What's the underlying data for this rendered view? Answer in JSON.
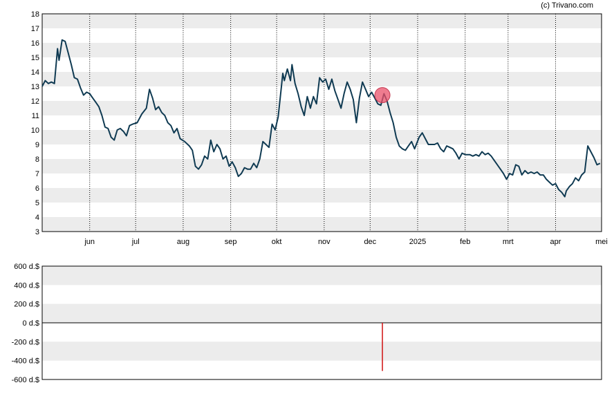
{
  "credit": "(c) Trivano.com",
  "chart_data": [
    {
      "type": "line",
      "ylim": [
        3,
        18
      ],
      "yticks": [
        "3",
        "4",
        "5",
        "6",
        "7",
        "8",
        "9",
        "10",
        "11",
        "12",
        "13",
        "14",
        "15",
        "16",
        "17",
        "18"
      ],
      "x_range": [
        "2024-05-01",
        "2025-05-01"
      ],
      "xtick_labels": [
        {
          "date": "2024-06-01",
          "label": "jun"
        },
        {
          "date": "2024-07-01",
          "label": "jul"
        },
        {
          "date": "2024-08-01",
          "label": "aug"
        },
        {
          "date": "2024-09-01",
          "label": "sep"
        },
        {
          "date": "2024-10-01",
          "label": "okt"
        },
        {
          "date": "2024-11-01",
          "label": "nov"
        },
        {
          "date": "2024-12-01",
          "label": "dec"
        },
        {
          "date": "2025-01-01",
          "label": "2025"
        },
        {
          "date": "2025-02-01",
          "label": "feb"
        },
        {
          "date": "2025-03-01",
          "label": "mrt"
        },
        {
          "date": "2025-04-01",
          "label": "apr"
        },
        {
          "date": "2025-05-01",
          "label": "mei"
        }
      ],
      "grid": "horizontal bands + dotted vertical lines",
      "line_color": "#0f3a52",
      "series": [
        {
          "points": [
            [
              "2024-05-01",
              13.0
            ],
            [
              "2024-05-03",
              13.4
            ],
            [
              "2024-05-05",
              13.2
            ],
            [
              "2024-05-07",
              13.3
            ],
            [
              "2024-05-09",
              13.2
            ],
            [
              "2024-05-11",
              15.6
            ],
            [
              "2024-05-12",
              14.8
            ],
            [
              "2024-05-14",
              16.2
            ],
            [
              "2024-05-16",
              16.1
            ],
            [
              "2024-05-18",
              15.3
            ],
            [
              "2024-05-20",
              14.5
            ],
            [
              "2024-05-22",
              13.6
            ],
            [
              "2024-05-24",
              13.5
            ],
            [
              "2024-05-26",
              12.9
            ],
            [
              "2024-05-28",
              12.4
            ],
            [
              "2024-05-30",
              12.6
            ],
            [
              "2024-06-01",
              12.5
            ],
            [
              "2024-06-03",
              12.2
            ],
            [
              "2024-06-05",
              11.9
            ],
            [
              "2024-06-07",
              11.6
            ],
            [
              "2024-06-09",
              11.0
            ],
            [
              "2024-06-11",
              10.2
            ],
            [
              "2024-06-13",
              10.1
            ],
            [
              "2024-06-15",
              9.5
            ],
            [
              "2024-06-17",
              9.3
            ],
            [
              "2024-06-19",
              10.0
            ],
            [
              "2024-06-21",
              10.1
            ],
            [
              "2024-06-23",
              9.9
            ],
            [
              "2024-06-25",
              9.6
            ],
            [
              "2024-06-27",
              10.3
            ],
            [
              "2024-06-29",
              10.4
            ],
            [
              "2024-07-02",
              10.5
            ],
            [
              "2024-07-05",
              11.1
            ],
            [
              "2024-07-08",
              11.5
            ],
            [
              "2024-07-10",
              12.8
            ],
            [
              "2024-07-12",
              12.2
            ],
            [
              "2024-07-14",
              11.4
            ],
            [
              "2024-07-16",
              11.6
            ],
            [
              "2024-07-18",
              11.2
            ],
            [
              "2024-07-20",
              11.0
            ],
            [
              "2024-07-22",
              10.5
            ],
            [
              "2024-07-24",
              10.3
            ],
            [
              "2024-07-26",
              9.8
            ],
            [
              "2024-07-28",
              10.1
            ],
            [
              "2024-07-30",
              9.4
            ],
            [
              "2024-08-02",
              9.2
            ],
            [
              "2024-08-05",
              8.9
            ],
            [
              "2024-08-07",
              8.6
            ],
            [
              "2024-08-09",
              7.5
            ],
            [
              "2024-08-11",
              7.3
            ],
            [
              "2024-08-13",
              7.6
            ],
            [
              "2024-08-15",
              8.2
            ],
            [
              "2024-08-17",
              8.0
            ],
            [
              "2024-08-19",
              9.3
            ],
            [
              "2024-08-21",
              8.5
            ],
            [
              "2024-08-23",
              9.0
            ],
            [
              "2024-08-25",
              8.7
            ],
            [
              "2024-08-27",
              8.0
            ],
            [
              "2024-08-29",
              8.2
            ],
            [
              "2024-08-31",
              7.5
            ],
            [
              "2024-09-02",
              7.8
            ],
            [
              "2024-09-04",
              7.4
            ],
            [
              "2024-09-06",
              6.8
            ],
            [
              "2024-09-08",
              7.0
            ],
            [
              "2024-09-10",
              7.4
            ],
            [
              "2024-09-12",
              7.3
            ],
            [
              "2024-09-14",
              7.3
            ],
            [
              "2024-09-16",
              7.7
            ],
            [
              "2024-09-18",
              7.4
            ],
            [
              "2024-09-20",
              8.0
            ],
            [
              "2024-09-22",
              9.2
            ],
            [
              "2024-09-24",
              9.0
            ],
            [
              "2024-09-26",
              8.8
            ],
            [
              "2024-09-28",
              10.4
            ],
            [
              "2024-09-30",
              10.0
            ],
            [
              "2024-10-02",
              10.9
            ],
            [
              "2024-10-04",
              12.9
            ],
            [
              "2024-10-05",
              13.9
            ],
            [
              "2024-10-06",
              13.4
            ],
            [
              "2024-10-08",
              14.2
            ],
            [
              "2024-10-10",
              13.4
            ],
            [
              "2024-10-11",
              14.5
            ],
            [
              "2024-10-13",
              13.2
            ],
            [
              "2024-10-15",
              12.5
            ],
            [
              "2024-10-17",
              11.6
            ],
            [
              "2024-10-19",
              11.0
            ],
            [
              "2024-10-21",
              12.3
            ],
            [
              "2024-10-23",
              11.5
            ],
            [
              "2024-10-25",
              12.3
            ],
            [
              "2024-10-27",
              11.8
            ],
            [
              "2024-10-29",
              13.6
            ],
            [
              "2024-10-31",
              13.3
            ],
            [
              "2024-11-02",
              13.5
            ],
            [
              "2024-11-04",
              12.8
            ],
            [
              "2024-11-06",
              13.5
            ],
            [
              "2024-11-08",
              12.7
            ],
            [
              "2024-11-10",
              12.1
            ],
            [
              "2024-11-12",
              11.5
            ],
            [
              "2024-11-14",
              12.5
            ],
            [
              "2024-11-16",
              13.3
            ],
            [
              "2024-11-18",
              12.8
            ],
            [
              "2024-11-20",
              12.1
            ],
            [
              "2024-11-22",
              10.5
            ],
            [
              "2024-11-24",
              12.2
            ],
            [
              "2024-11-26",
              13.3
            ],
            [
              "2024-11-28",
              12.8
            ],
            [
              "2024-11-30",
              12.3
            ],
            [
              "2024-12-02",
              12.6
            ],
            [
              "2024-12-04",
              12.2
            ],
            [
              "2024-12-06",
              11.8
            ],
            [
              "2024-12-08",
              11.7
            ],
            [
              "2024-12-10",
              12.5
            ],
            [
              "2024-12-12",
              12.0
            ],
            [
              "2024-12-14",
              11.2
            ],
            [
              "2024-12-16",
              10.5
            ],
            [
              "2024-12-18",
              9.5
            ],
            [
              "2024-12-20",
              8.9
            ],
            [
              "2024-12-22",
              8.7
            ],
            [
              "2024-12-24",
              8.6
            ],
            [
              "2024-12-26",
              8.9
            ],
            [
              "2024-12-28",
              9.2
            ],
            [
              "2024-12-30",
              8.7
            ],
            [
              "2025-01-02",
              9.5
            ],
            [
              "2025-01-04",
              9.8
            ],
            [
              "2025-01-06",
              9.4
            ],
            [
              "2025-01-08",
              9.0
            ],
            [
              "2025-01-10",
              9.0
            ],
            [
              "2025-01-12",
              9.0
            ],
            [
              "2025-01-14",
              9.1
            ],
            [
              "2025-01-16",
              8.7
            ],
            [
              "2025-01-18",
              8.5
            ],
            [
              "2025-01-20",
              8.9
            ],
            [
              "2025-01-22",
              8.8
            ],
            [
              "2025-01-24",
              8.7
            ],
            [
              "2025-01-26",
              8.4
            ],
            [
              "2025-01-28",
              8.0
            ],
            [
              "2025-01-30",
              8.4
            ],
            [
              "2025-02-01",
              8.3
            ],
            [
              "2025-02-04",
              8.3
            ],
            [
              "2025-02-06",
              8.2
            ],
            [
              "2025-02-08",
              8.3
            ],
            [
              "2025-02-10",
              8.2
            ],
            [
              "2025-02-12",
              8.5
            ],
            [
              "2025-02-14",
              8.3
            ],
            [
              "2025-02-16",
              8.4
            ],
            [
              "2025-02-18",
              8.2
            ],
            [
              "2025-02-20",
              7.9
            ],
            [
              "2025-02-22",
              7.6
            ],
            [
              "2025-02-24",
              7.3
            ],
            [
              "2025-02-26",
              7.0
            ],
            [
              "2025-02-28",
              6.6
            ],
            [
              "2025-03-02",
              7.0
            ],
            [
              "2025-03-04",
              6.9
            ],
            [
              "2025-03-06",
              7.6
            ],
            [
              "2025-03-08",
              7.5
            ],
            [
              "2025-03-10",
              6.9
            ],
            [
              "2025-03-12",
              7.2
            ],
            [
              "2025-03-14",
              7.0
            ],
            [
              "2025-03-16",
              7.1
            ],
            [
              "2025-03-18",
              7.0
            ],
            [
              "2025-03-20",
              7.1
            ],
            [
              "2025-03-22",
              6.9
            ],
            [
              "2025-03-24",
              6.9
            ],
            [
              "2025-03-26",
              6.6
            ],
            [
              "2025-03-28",
              6.4
            ],
            [
              "2025-03-30",
              6.2
            ],
            [
              "2025-04-01",
              6.3
            ],
            [
              "2025-04-03",
              5.9
            ],
            [
              "2025-04-05",
              5.7
            ],
            [
              "2025-04-07",
              5.4
            ],
            [
              "2025-04-08",
              5.8
            ],
            [
              "2025-04-10",
              6.1
            ],
            [
              "2025-04-12",
              6.3
            ],
            [
              "2025-04-14",
              6.7
            ],
            [
              "2025-04-16",
              6.5
            ],
            [
              "2025-04-18",
              6.9
            ],
            [
              "2025-04-20",
              7.1
            ],
            [
              "2025-04-22",
              8.9
            ],
            [
              "2025-04-24",
              8.5
            ],
            [
              "2025-04-26",
              8.1
            ],
            [
              "2025-04-28",
              7.6
            ],
            [
              "2025-04-30",
              7.7
            ]
          ]
        }
      ],
      "marker": {
        "date": "2024-12-09",
        "value": 12.4,
        "color": "#e9506a"
      }
    },
    {
      "type": "bar",
      "ylim": [
        -600,
        600
      ],
      "yticks": [
        "600 d.$",
        "400 d.$",
        "200 d.$",
        "0 d.$",
        "-200 d.$",
        "-400 d.$",
        "-600 d.$"
      ],
      "grid": "horizontal bands",
      "bars": [
        {
          "date": "2024-12-09",
          "value": -510,
          "color": "#d01010"
        }
      ]
    }
  ]
}
